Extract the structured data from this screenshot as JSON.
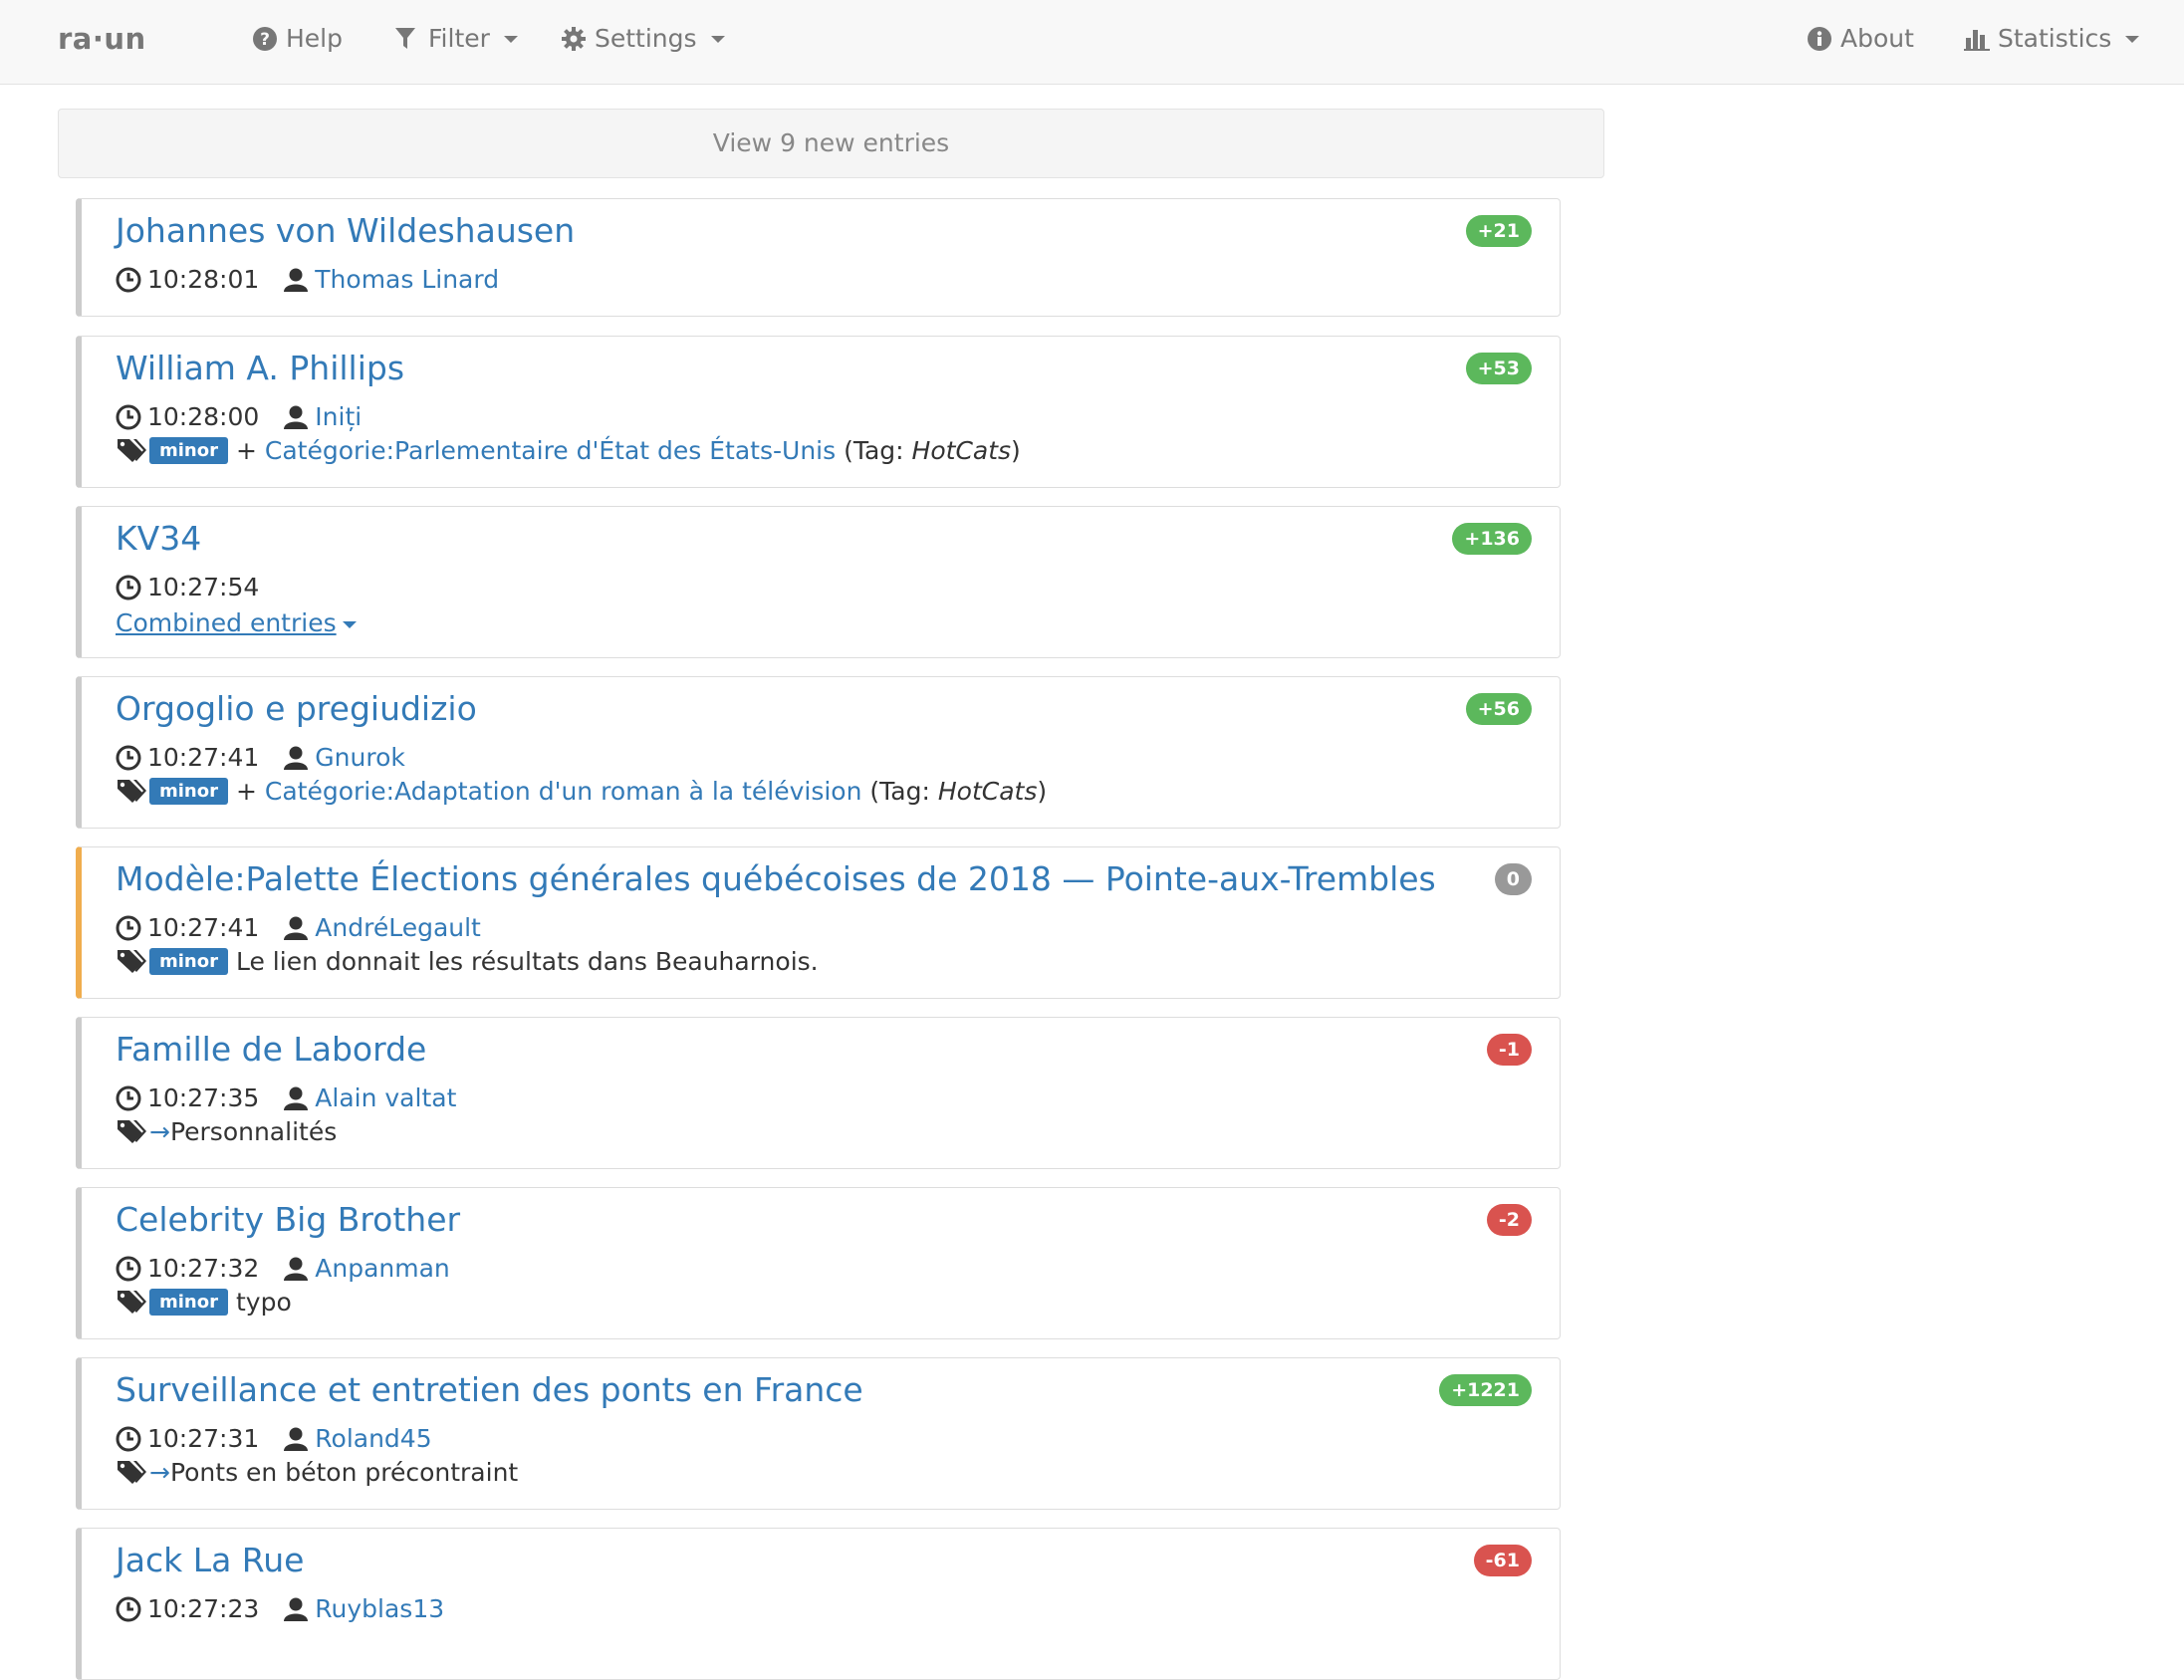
{
  "navbar": {
    "brand": "ra·un",
    "help": "Help",
    "filter": "Filter",
    "settings": "Settings",
    "about": "About",
    "statistics": "Statistics"
  },
  "new_entries": "View 9 new entries",
  "colors": {
    "positive": "#5cb85c",
    "negative": "#d9534f",
    "neutral": "#999999",
    "link": "#337ab7",
    "warning_border": "#f0ad4e"
  },
  "entries": [
    {
      "title": "Johannes von Wildeshausen",
      "badge": "+21",
      "time": "10:28:01",
      "user": "Thomas Linard"
    },
    {
      "title": "William A. Phillips",
      "badge": "+53",
      "time": "10:28:00",
      "user": "Iniți",
      "minor": "minor",
      "prefix": "+",
      "link": "Catégorie:Parlementaire d'État des États-Unis",
      "tag_open": "(Tag:",
      "tag_name": "HotCats",
      "tag_close": ")"
    },
    {
      "title": "KV34",
      "badge": "+136",
      "time": "10:27:54",
      "combined": "Combined entries"
    },
    {
      "title": "Orgoglio e pregiudizio",
      "badge": "+56",
      "time": "10:27:41",
      "user": "Gnurok",
      "minor": "minor",
      "prefix": "+",
      "link": "Catégorie:Adaptation d'un roman à la télévision",
      "tag_open": "(Tag:",
      "tag_name": "HotCats",
      "tag_close": ")"
    },
    {
      "title": "Modèle:Palette Élections générales québécoises de 2018 — Pointe-aux-Trembles",
      "badge": "0",
      "time": "10:27:41",
      "user": "AndréLegault",
      "minor": "minor",
      "comment": "Le lien donnait les résultats dans Beauharnois."
    },
    {
      "title": "Famille de Laborde",
      "badge": "-1",
      "time": "10:27:35",
      "user": "Alain valtat",
      "arrow": "→",
      "comment": "Personnalités"
    },
    {
      "title": "Celebrity Big Brother",
      "badge": "-2",
      "time": "10:27:32",
      "user": "Anpanman",
      "minor": "minor",
      "comment": "typo"
    },
    {
      "title": "Surveillance et entretien des ponts en France",
      "badge": "+1221",
      "time": "10:27:31",
      "user": "Roland45",
      "arrow": "→",
      "comment": "Ponts en béton précontraint"
    },
    {
      "title": "Jack La Rue",
      "badge": "-61",
      "time": "10:27:23",
      "user": "Ruyblas13"
    }
  ]
}
